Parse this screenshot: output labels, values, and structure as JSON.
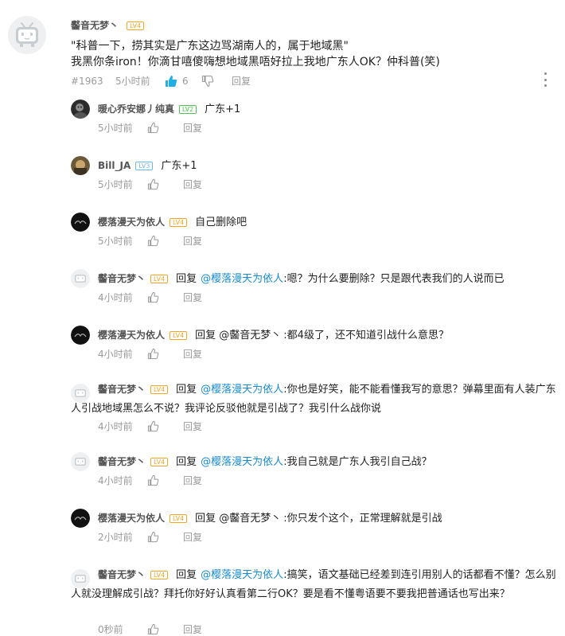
{
  "main": {
    "username": "齾音无梦丶",
    "level": "LV4",
    "lines": [
      "\"科普一下，捞其实是广东这边骂湖南人的，属于地域黑\"",
      "我黑你条iron！你滴甘嘻傻嗨想地域黑唔好拉上我地广东人OK？仲科普(笑)"
    ],
    "floor": "#1963",
    "time": "5小时前",
    "likes": "6",
    "reply_label": "回复"
  },
  "replies": [
    {
      "username": "暖心乔安娜丿纯真",
      "level": "LV2",
      "action": "",
      "mention": "",
      "text": "广东+1",
      "time": "5小时前",
      "reply_label": "回复"
    },
    {
      "username": "Bill_JA",
      "level": "LV3",
      "action": "",
      "mention": "",
      "text": "广东+1",
      "time": "5小时前",
      "reply_label": "回复"
    },
    {
      "username": "樱落漫天为依人",
      "level": "LV4",
      "action": "",
      "mention": "",
      "text": "自己删除吧",
      "time": "5小时前",
      "reply_label": "回复"
    },
    {
      "username": "齾音无梦丶",
      "level": "LV4",
      "action": "回复",
      "mention": "@樱落漫天为依人",
      "text": ":嗯？为什么要删除？只是跟代表我们的人说而已",
      "time": "4小时前",
      "reply_label": "回复"
    },
    {
      "username": "樱落漫天为依人",
      "level": "LV4",
      "action": "回复 @齾音无梦丶",
      "mention": "",
      "text": ":都4级了，还不知道引战什么意思？",
      "time": "4小时前",
      "reply_label": "回复"
    },
    {
      "username": "齾音无梦丶",
      "level": "LV4",
      "action": "回复",
      "mention": "@樱落漫天为依人",
      "text": ":你也是好笑，能不能看懂我写的意思？弹幕里面有人装广东人引战地域黑怎么不说？我评论反驳他就是引战了？我引什么战你说",
      "time": "4小时前",
      "reply_label": "回复"
    },
    {
      "username": "齾音无梦丶",
      "level": "LV4",
      "action": "回复",
      "mention": "@樱落漫天为依人",
      "text": ":我自己就是广东人我引自己战？",
      "time": "4小时前",
      "reply_label": "回复"
    },
    {
      "username": "樱落漫天为依人",
      "level": "LV4",
      "action": "回复 @齾音无梦丶",
      "mention": "",
      "text": ":你只发个这个，正常理解就是引战",
      "time": "2小时前",
      "reply_label": "回复"
    },
    {
      "username": "齾音无梦丶",
      "level": "LV4",
      "action": "回复",
      "mention": "@樱落漫天为依人",
      "text": ":搞笑，语文基础已经差到连引用别人的话都看不懂？怎么别人就没理解成引战？拜托你好好认真看第二行OK？要是看不懂粤语要不要我把普通话也写出来？",
      "time": "0秒前",
      "reply_label": "回复"
    }
  ],
  "colors": {
    "mention": "#178bcf",
    "like_active": "#23ade5",
    "level_orange": "#f5a623",
    "level_green": "#4fc34f",
    "level_blue": "#6bb8f0"
  },
  "icons": {
    "like": "thumb-up-icon",
    "dislike": "thumb-down-icon",
    "more": "more-vertical-icon",
    "default_avatar": "tv-avatar-icon"
  }
}
